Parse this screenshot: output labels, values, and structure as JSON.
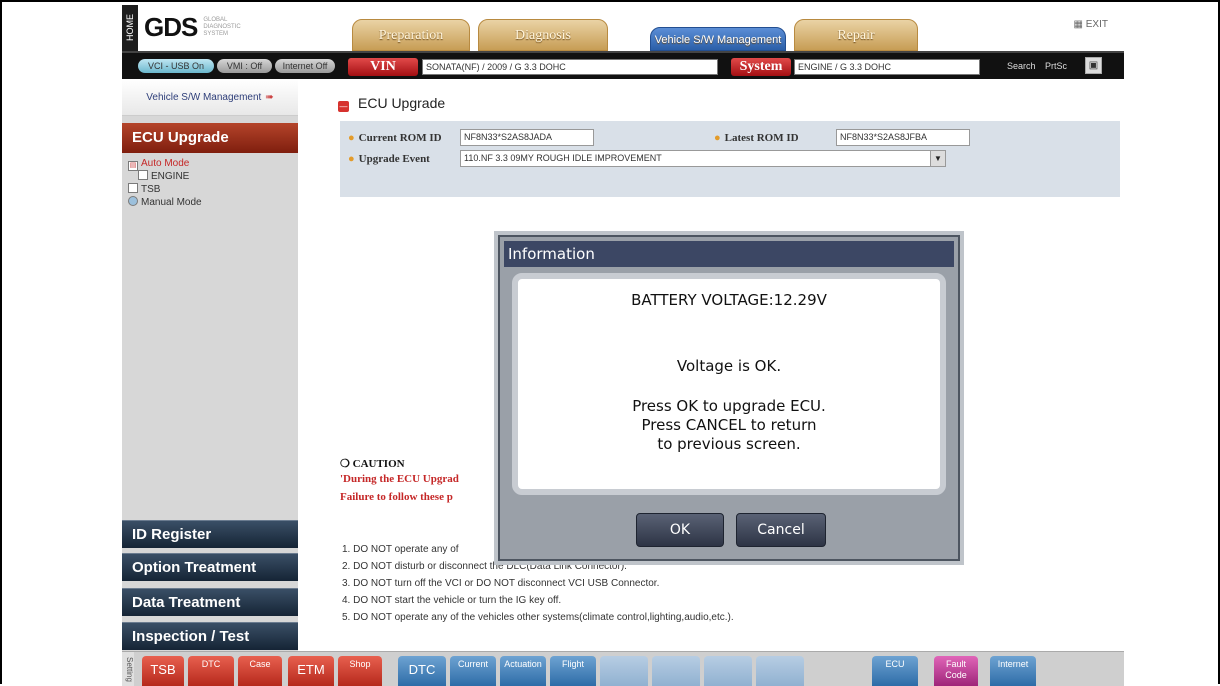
{
  "header": {
    "home_tab": "HOME",
    "logo": "GDS",
    "logo_sub": "GLOBAL DIAGNOSTIC SYSTEM",
    "tabs": [
      {
        "label": "Preparation"
      },
      {
        "label": "Diagnosis"
      },
      {
        "label": "Vehicle S/W Management"
      },
      {
        "label": "Repair"
      }
    ],
    "exit_label": "EXIT"
  },
  "status": {
    "vci": "VCI - USB On",
    "vmi": "VMI : Off",
    "internet": "Internet Off",
    "vin_label": "VIN",
    "vin_value": "SONATA(NF) / 2009 / G 3.3 DOHC",
    "system_label": "System",
    "system_value": "ENGINE / G 3.3 DOHC",
    "search": "Search",
    "prtsc": "PrtSc"
  },
  "sidebar": {
    "subtitle": "Vehicle S/W Management",
    "section": "ECU Upgrade",
    "tree": [
      {
        "label": "Auto Mode"
      },
      {
        "label": "ENGINE"
      },
      {
        "label": "TSB"
      },
      {
        "label": "Manual Mode"
      }
    ],
    "nav": [
      {
        "label": "ID Register"
      },
      {
        "label": "Option Treatment"
      },
      {
        "label": "Data Treatment"
      },
      {
        "label": "Inspection / Test"
      }
    ]
  },
  "main": {
    "title": "ECU Upgrade",
    "current_rom_label": "Current ROM ID",
    "current_rom_value": "NF8N33*S2AS8JADA",
    "latest_rom_label": "Latest ROM ID",
    "latest_rom_value": "NF8N33*S2AS8JFBA",
    "upgrade_event_label": "Upgrade Event",
    "upgrade_event_value": "110.NF 3.3 09MY ROUGH IDLE IMPROVEMENT",
    "caution_head": "CAUTION",
    "caution_line1": "'During the ECU Upgrad",
    "caution_line2": "Failure to follow these p",
    "rules": [
      "1. DO NOT operate any of",
      "2. DO NOT disturb or disconnect the DLC(Data Link Connector).",
      "3. DO NOT turn off the VCI or DO NOT disconnect VCI USB Connector.",
      "4. DO NOT start the vehicle or turn the IG key off.",
      "5. DO NOT operate any of the vehicles other systems(climate control,lighting,audio,etc.)."
    ]
  },
  "dialog": {
    "title": "Information",
    "line1": "BATTERY VOLTAGE:12.29V",
    "line2": "Voltage is OK.",
    "line3": "Press OK to upgrade ECU.",
    "line4": "Press CANCEL to return",
    "line5": "to previous screen.",
    "ok": "OK",
    "cancel": "Cancel"
  },
  "toolbar": {
    "side_label": "Setting",
    "tsb": "TSB",
    "dtc_red": "DTC",
    "case": "Case",
    "etm": "ETM",
    "shop": "Shop",
    "dtc_blue": "DTC",
    "current": "Current",
    "actuation": "Actuation",
    "flight": "Flight",
    "ecu": "ECU",
    "fault_code": "Fault Code",
    "internet": "Internet"
  }
}
